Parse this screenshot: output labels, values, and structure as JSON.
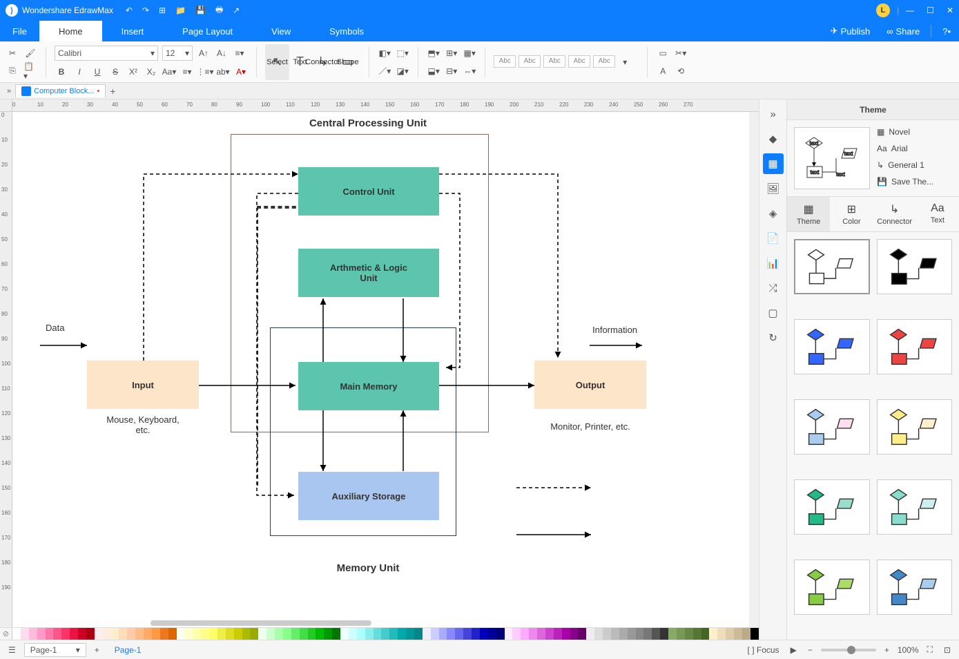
{
  "app": {
    "title": "Wondershare EdrawMax",
    "user_initial": "L"
  },
  "menu": {
    "file": "File",
    "home": "Home",
    "insert": "Insert",
    "page_layout": "Page Layout",
    "view": "View",
    "symbols": "Symbols",
    "publish": "Publish",
    "share": "Share"
  },
  "ribbon": {
    "font_name": "Calibri",
    "font_size": "12",
    "select": "Select",
    "text": "Text",
    "connector": "Connector",
    "shape": "Shape",
    "swatch": "Abc"
  },
  "doctab": {
    "name": "Computer Block..."
  },
  "diagram": {
    "title_top": "Central Processing Unit",
    "title_bottom": "Memory Unit",
    "control_unit": "Control Unit",
    "alu": "Arthmetic & Logic\nUnit",
    "main_memory": "Main Memory",
    "aux_storage": "Auxiliary Storage",
    "input": "Input",
    "output": "Output",
    "data": "Data",
    "information": "Information",
    "input_sub": "Mouse, Keyboard,\netc.",
    "output_sub": "Monitor, Printer, etc."
  },
  "rpanel": {
    "title": "Theme",
    "novel": "Novel",
    "arial": "Arial",
    "general": "General 1",
    "save": "Save The...",
    "tab_theme": "Theme",
    "tab_color": "Color",
    "tab_connector": "Connector",
    "tab_text": "Text",
    "thumb_text": "text"
  },
  "bottom": {
    "page": "Page-1",
    "page_tab": "Page-1",
    "focus": "Focus",
    "zoom": "100%"
  },
  "ruler_h": [
    "0",
    "10",
    "20",
    "30",
    "40",
    "50",
    "60",
    "70",
    "80",
    "90",
    "100",
    "110",
    "120",
    "130",
    "140",
    "150",
    "160",
    "170",
    "180",
    "190",
    "200",
    "210",
    "220",
    "230",
    "240",
    "250",
    "260",
    "270"
  ],
  "ruler_v": [
    "0",
    "10",
    "20",
    "30",
    "40",
    "50",
    "60",
    "70",
    "80",
    "90",
    "100",
    "110",
    "120",
    "130",
    "140",
    "150",
    "160",
    "170",
    "180",
    "190"
  ]
}
